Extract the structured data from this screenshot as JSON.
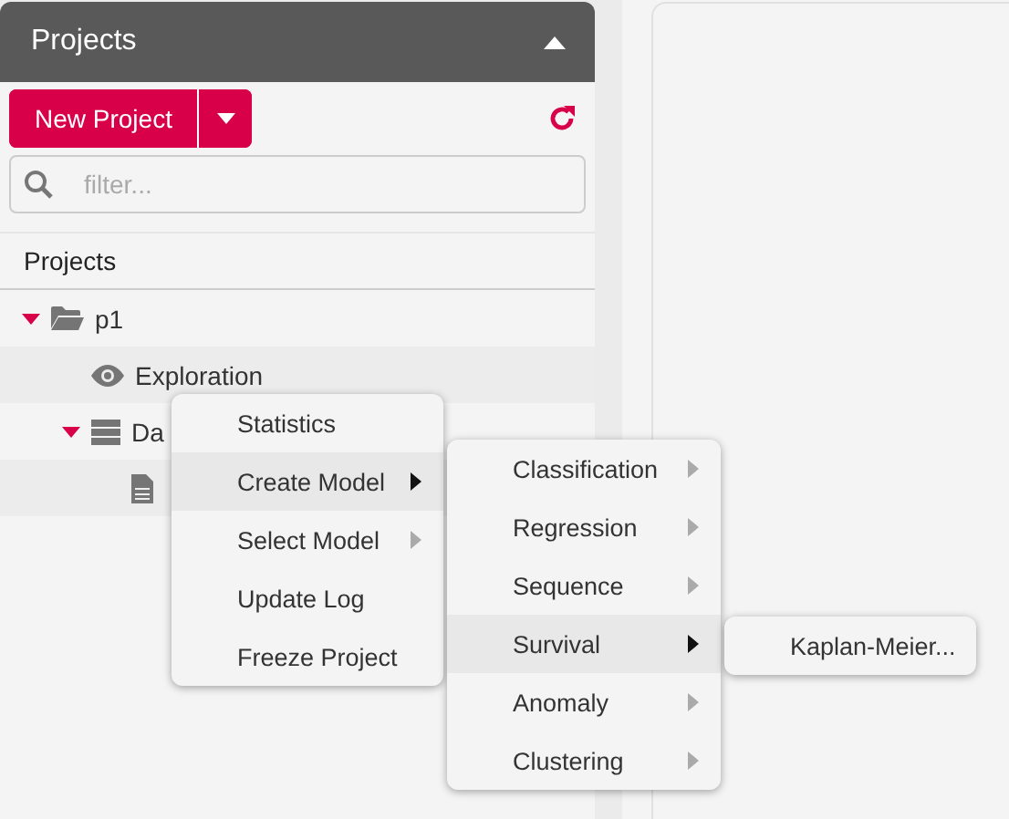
{
  "panel": {
    "title": "Projects",
    "expanded": true
  },
  "toolbar": {
    "new_button": "New Project"
  },
  "search": {
    "placeholder": "filter..."
  },
  "tree": {
    "heading": "Projects",
    "items": [
      {
        "kind": "folder",
        "label": "p1",
        "expanded": true,
        "children": [
          {
            "kind": "view",
            "label": "Exploration"
          },
          {
            "kind": "data",
            "label": "Da",
            "expanded": true,
            "children": [
              {
                "kind": "file"
              }
            ]
          }
        ]
      }
    ]
  },
  "context_menu": {
    "items": [
      {
        "label": "Statistics",
        "submenu": false,
        "selected": false
      },
      {
        "label": "Create Model",
        "submenu": true,
        "selected": true
      },
      {
        "label": "Select Model",
        "submenu": true,
        "selected": false
      },
      {
        "label": "Update Log",
        "submenu": false,
        "selected": false
      },
      {
        "label": "Freeze Project",
        "submenu": false,
        "selected": false
      }
    ]
  },
  "submenu": {
    "items": [
      {
        "label": "Classification",
        "submenu": true,
        "selected": false
      },
      {
        "label": "Regression",
        "submenu": true,
        "selected": false
      },
      {
        "label": "Sequence",
        "submenu": true,
        "selected": false
      },
      {
        "label": "Survival",
        "submenu": true,
        "selected": true
      },
      {
        "label": "Anomaly",
        "submenu": true,
        "selected": false
      },
      {
        "label": "Clustering",
        "submenu": true,
        "selected": false
      }
    ]
  },
  "submenu_2": {
    "items": [
      {
        "label": "Kaplan-Meier...",
        "submenu": false,
        "selected": false
      }
    ]
  }
}
